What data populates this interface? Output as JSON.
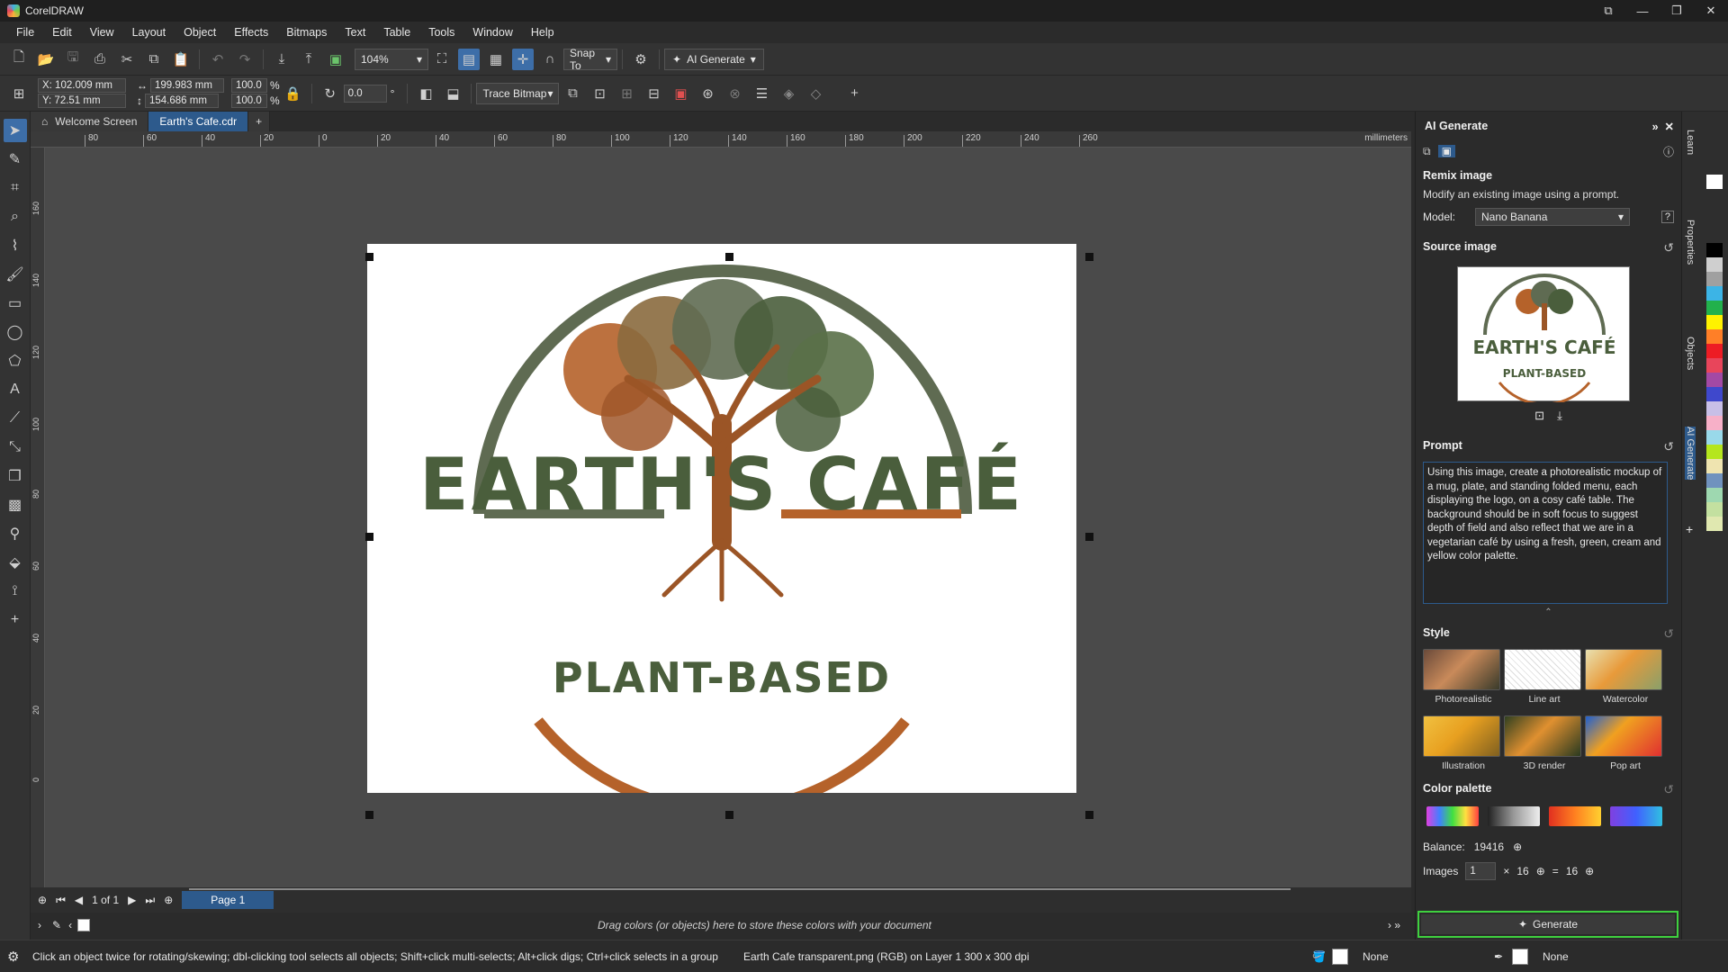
{
  "app": {
    "title": "CorelDRAW"
  },
  "menu": [
    "File",
    "Edit",
    "View",
    "Layout",
    "Object",
    "Effects",
    "Bitmaps",
    "Text",
    "Table",
    "Tools",
    "Window",
    "Help"
  ],
  "toolbar": {
    "zoom": "104%",
    "snap_to": "Snap To",
    "ai_generate": "AI Generate"
  },
  "propbar": {
    "x": "X: 102.009 mm",
    "y": "Y: 72.51 mm",
    "width": "199.983 mm",
    "height": "154.686 mm",
    "scale_w": "100.0",
    "scale_h": "100.0",
    "pct": "%",
    "rotation": "0.0",
    "deg": "°",
    "trace_bitmap": "Trace Bitmap"
  },
  "tabs": [
    "Welcome Screen",
    "Earth's Cafe.cdr"
  ],
  "ruler": {
    "unit": "millimeters",
    "h_ticks": [
      "80",
      "60",
      "40",
      "20",
      "0",
      "20",
      "40",
      "60",
      "80",
      "100",
      "120",
      "140",
      "160",
      "180",
      "200",
      "220",
      "240",
      "260"
    ],
    "v_ticks": [
      "160",
      "140",
      "120",
      "100",
      "80",
      "60",
      "40",
      "20",
      "0"
    ]
  },
  "logo": {
    "line1": "EARTH'S CAFÉ",
    "line2": "PLANT-BASED"
  },
  "pagebar": {
    "page_of": "1 of 1",
    "page_tab": "Page 1"
  },
  "colorbar": {
    "hint": "Drag colors (or objects) here to store these colors with your document"
  },
  "status": {
    "message": "Click an object twice for rotating/skewing; dbl-clicking tool selects all objects; Shift+click multi-selects; Alt+click digs; Ctrl+click selects in a group",
    "file_info": "Earth Cafe transparent.png (RGB) on Layer 1  300 x 300 dpi",
    "fill": "None",
    "outline": "None"
  },
  "docker": {
    "title": "AI Generate",
    "mode_title": "Remix image",
    "mode_desc": "Modify an existing image using a prompt.",
    "model_label": "Model:",
    "model_value": "Nano Banana",
    "source_title": "Source image",
    "prompt_title": "Prompt",
    "prompt_text": "Using this image, create a photorealistic mockup of a mug, plate, and standing folded menu, each displaying the logo, on a cosy café table.  The background should be in soft focus to suggest depth of field and also reflect that we are in a vegetarian café by using a fresh, green, cream and yellow color palette.",
    "style_title": "Style",
    "styles": [
      "Photorealistic",
      "Line art",
      "Watercolor",
      "Illustration",
      "3D render",
      "Pop art"
    ],
    "palette_title": "Color palette",
    "balance_label": "Balance:",
    "balance_value": "19416",
    "images_label": "Images",
    "images_count": "1",
    "times": "×",
    "per_image": "16",
    "equals": "=",
    "total": "16",
    "generate": "Generate"
  },
  "side_tabs": [
    "Learn",
    "Properties",
    "Objects",
    "AI Generate"
  ],
  "colors": {
    "accent": "#2d5a8c",
    "generate_border": "#3fd13f",
    "logo_green": "#4a5e3c",
    "logo_orange": "#b5622a"
  }
}
